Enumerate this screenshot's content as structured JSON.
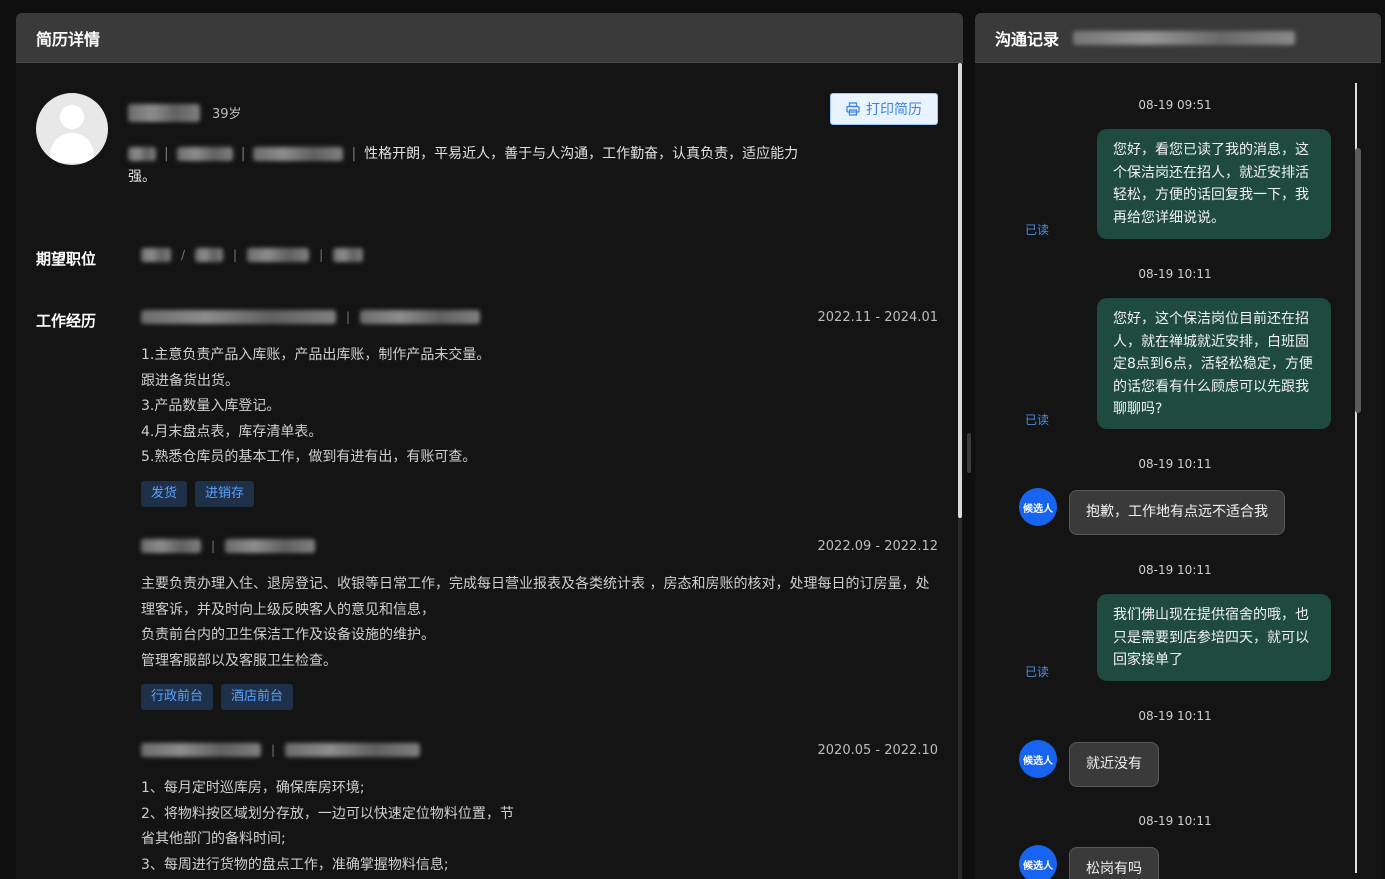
{
  "resume": {
    "title": "简历详情",
    "age": "39岁",
    "summary_text": "性格开朗，平易近人，善于与人沟通，工作勤奋，认真负责，适应能力强。",
    "print_label": "打印简历",
    "expect_label": "期望职位",
    "work_label": "工作经历",
    "jobs": [
      {
        "date": "2022.11 - 2024.01",
        "desc": [
          "1.主意负责产品入库账，产品出库账，制作产品未交量。",
          "跟进备货出货。",
          "3.产品数量入库登记。",
          "4.月末盘点表，库存清单表。",
          "5.熟悉仓库员的基本工作，做到有进有出，有账可查。"
        ],
        "tags": [
          "发货",
          "进销存"
        ]
      },
      {
        "date": "2022.09 - 2022.12",
        "desc": [
          "主要负责办理入住、退房登记、收银等日常工作，完成每日营业报表及各类统计表 ，房态和房账的核对，处理每日的订房量，处",
          "理客诉，并及时向上级反映客人的意见和信息，",
          "负责前台内的卫生保洁工作及设备设施的维护。",
          "管理客服部以及客服卫生检查。"
        ],
        "tags": [
          "行政前台",
          "酒店前台"
        ]
      },
      {
        "date": "2020.05 - 2022.10",
        "desc": [
          "1、每月定时巡库房，确保库房环境;",
          "2、将物料按区域划分存放，一边可以快速定位物料位置，节",
          "省其他部门的备料时间;",
          "3、每周进行货物的盘点工作，准确掌握物料信息;"
        ],
        "tags": []
      }
    ]
  },
  "chat": {
    "title": "沟通记录",
    "read_label": "已读",
    "candidate_label": "候选人",
    "messages": [
      {
        "time": "08-19 09:51",
        "from": "me",
        "text": "您好，看您已读了我的消息，这个保洁岗还在招人，就近安排活轻松，方便的话回复我一下，我再给您详细说说。"
      },
      {
        "time": "08-19 10:11",
        "from": "me",
        "text": "您好，这个保洁岗位目前还在招人，就在禅城就近安排，白班固定8点到6点，活轻松稳定，方便的话您看有什么顾虑可以先跟我聊聊吗?"
      },
      {
        "time": "08-19 10:11",
        "from": "candidate",
        "text": "抱歉，工作地有点远不适合我"
      },
      {
        "time": "08-19 10:11",
        "from": "me",
        "text": "我们佛山现在提供宿舍的哦，也只是需要到店参培四天，就可以回家接单了"
      },
      {
        "time": "08-19 10:11",
        "from": "candidate",
        "text": "就近没有"
      },
      {
        "time": "08-19 10:11",
        "from": "candidate",
        "text": "松岗有吗"
      }
    ]
  }
}
